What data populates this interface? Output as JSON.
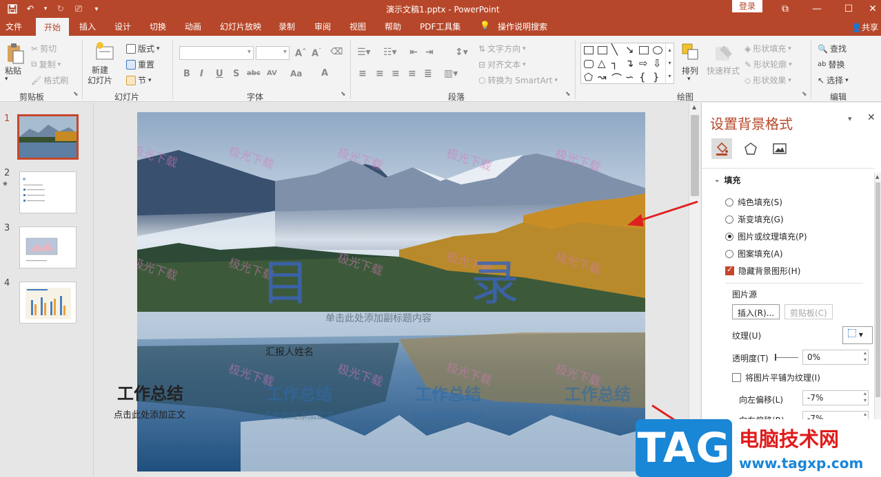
{
  "titlebar": {
    "title": "演示文稿1.pptx  -  PowerPoint",
    "login": "登录",
    "icons": [
      "save-icon",
      "undo-icon",
      "redo-icon",
      "presenter-icon",
      "customize-qat-icon"
    ]
  },
  "tabs": [
    "文件",
    "开始",
    "插入",
    "设计",
    "切换",
    "动画",
    "幻灯片放映",
    "录制",
    "审阅",
    "视图",
    "帮助",
    "PDF工具集",
    "操作说明搜索"
  ],
  "active_tab": "开始",
  "share": "共享",
  "ribbon": {
    "clipboard": {
      "paste": "粘贴",
      "cut": "剪切",
      "copy": "复制",
      "format_painter": "格式刷",
      "label": "剪贴板"
    },
    "slides": {
      "new_slide": "新建\n幻灯片",
      "layout": "版式",
      "reset": "重置",
      "section": "节",
      "label": "幻灯片"
    },
    "font": {
      "label": "字体",
      "buttons": [
        "B",
        "I",
        "U",
        "S",
        "abc",
        "AV",
        "Aa",
        "A"
      ]
    },
    "paragraph": {
      "text_direction": "文字方向",
      "align_text": "对齐文本",
      "smartart": "转换为 SmartArt",
      "label": "段落"
    },
    "drawing": {
      "arrange": "排列",
      "quick_styles": "快速样式",
      "shape_fill": "形状填充",
      "shape_outline": "形状轮廓",
      "shape_effects": "形状效果",
      "label": "绘图"
    },
    "editing": {
      "find": "查找",
      "replace": "替换",
      "select": "选择",
      "label": "编辑"
    }
  },
  "thumbnails": [
    {
      "num": "1",
      "selected": true
    },
    {
      "num": "2",
      "star": "★"
    },
    {
      "num": "3"
    },
    {
      "num": "4"
    }
  ],
  "slide": {
    "title_left": "目",
    "title_right": "录",
    "subtitle": "单击此处添加副标题内容",
    "reporter": "汇报人姓名",
    "watermark": "极光下载",
    "sections": [
      {
        "heading": "工作总结",
        "body": "点击此处添加正文"
      },
      {
        "heading": "工作总结",
        "body": "点击此处添加正文"
      },
      {
        "heading": "工作总结",
        "body": "点击此处添加正文"
      },
      {
        "heading": "工作总结",
        "body": "点击此处添加正文"
      }
    ]
  },
  "pane": {
    "title": "设置背景格式",
    "section": "填充",
    "options": [
      {
        "label": "纯色填充(S)",
        "checked": false
      },
      {
        "label": "渐变填充(G)",
        "checked": false
      },
      {
        "label": "图片或纹理填充(P)",
        "checked": true
      },
      {
        "label": "图案填充(A)",
        "checked": false
      }
    ],
    "hide_bg": "隐藏背景图形(H)",
    "picture_source": "图片源",
    "insert": "插入(R)...",
    "clipboard": "剪贴板(C)",
    "texture": "纹理(U)",
    "transparency": "透明度(T)",
    "transparency_value": "0%",
    "tile": "将图片平铺为纹理(I)",
    "offset_left": "向左偏移(L)",
    "offset_left_value": "-7%",
    "offset_right": "向右偏移(R)",
    "offset_right_value": "-7%"
  },
  "logo": {
    "tag": "TAG",
    "cn": "电脑技术网",
    "url": "www.tagxp.com"
  },
  "colors": {
    "accent": "#b7472a",
    "ribbon": "#f3f3f3",
    "logo_blue": "#1a86d6",
    "logo_red": "#e01b1b"
  }
}
